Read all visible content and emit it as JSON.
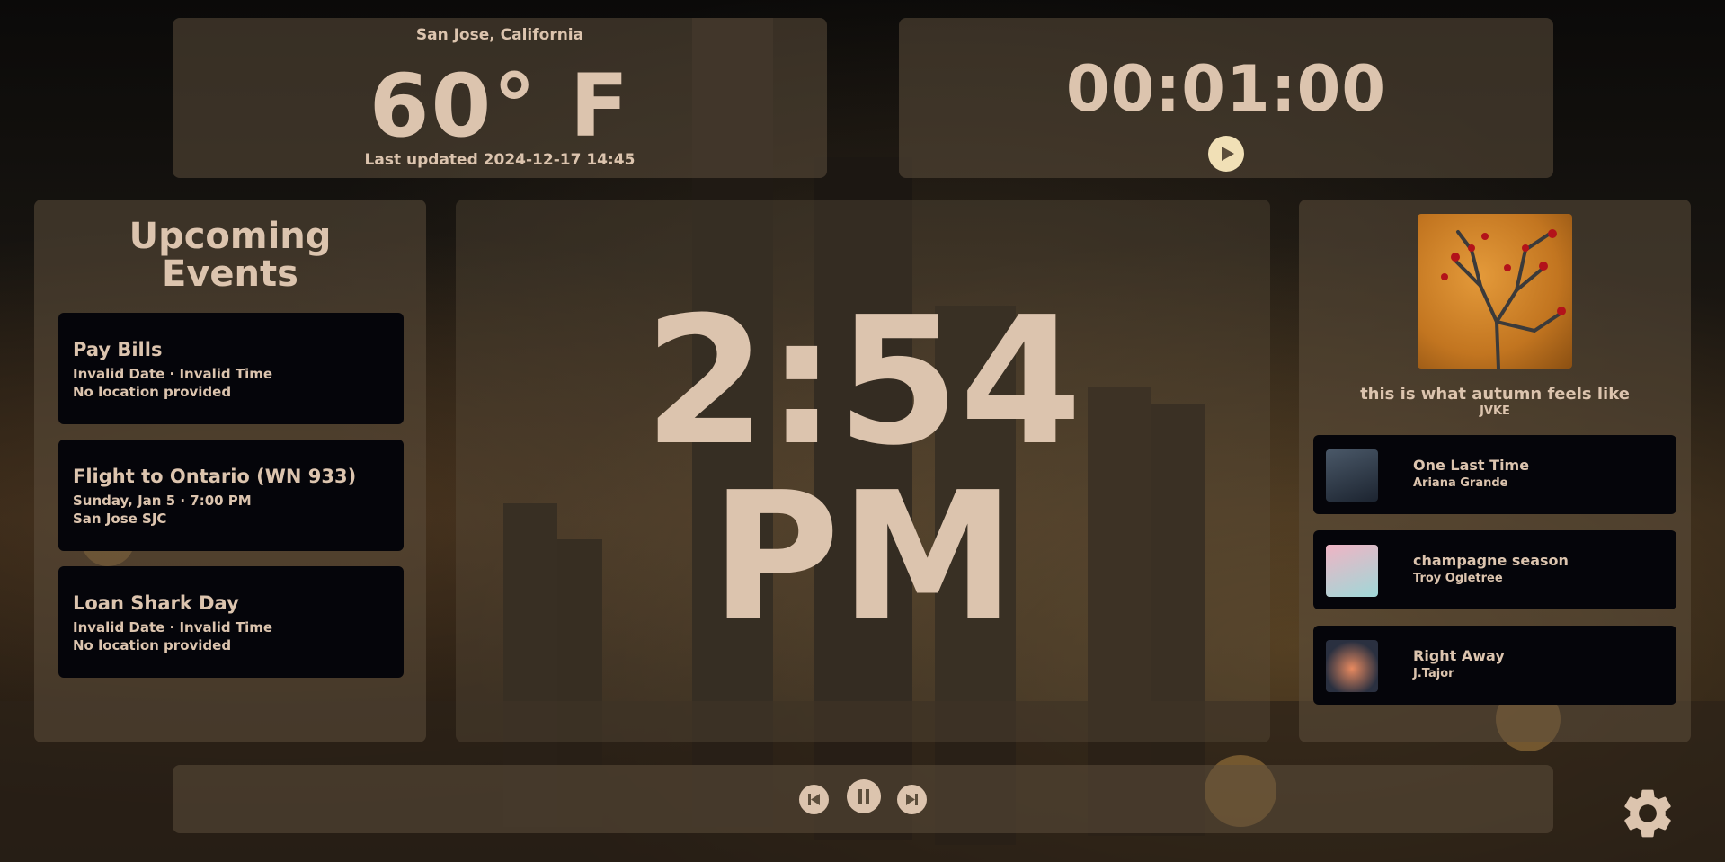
{
  "weather": {
    "location": "San Jose, California",
    "temperature": "60° F",
    "last_updated": "Last updated 2024-12-17 14:45"
  },
  "timer": {
    "time": "00:01:00",
    "play_icon": "play-icon"
  },
  "events": {
    "title_line1": "Upcoming",
    "title_line2": "Events",
    "items": [
      {
        "name": "Pay Bills",
        "when": "Invalid Date · Invalid Time",
        "where": "No location provided"
      },
      {
        "name": "Flight to Ontario (WN 933)",
        "when": "Sunday, Jan 5 · 7:00 PM",
        "where": "San Jose SJC"
      },
      {
        "name": "Loan Shark Day",
        "when": "Invalid Date · Invalid Time",
        "where": "No location provided"
      }
    ]
  },
  "clock": {
    "time": "2:54",
    "ampm": "PM"
  },
  "music": {
    "now_playing": {
      "title": "this is what autumn feels like",
      "artist": "JVKE"
    },
    "queue": [
      {
        "title": "One Last Time",
        "artist": "Ariana Grande"
      },
      {
        "title": "champagne season",
        "artist": "Troy Ogletree"
      },
      {
        "title": "Right Away",
        "artist": "J.Tajor"
      }
    ]
  },
  "controls": {
    "previous_icon": "skip-previous-icon",
    "pause_icon": "pause-icon",
    "next_icon": "skip-next-icon",
    "settings_icon": "gear-icon"
  },
  "colors": {
    "text": "#dcc4ae",
    "panel": "#5c4e3c",
    "card": "#05050a",
    "play_button": "#f1e0b6"
  }
}
